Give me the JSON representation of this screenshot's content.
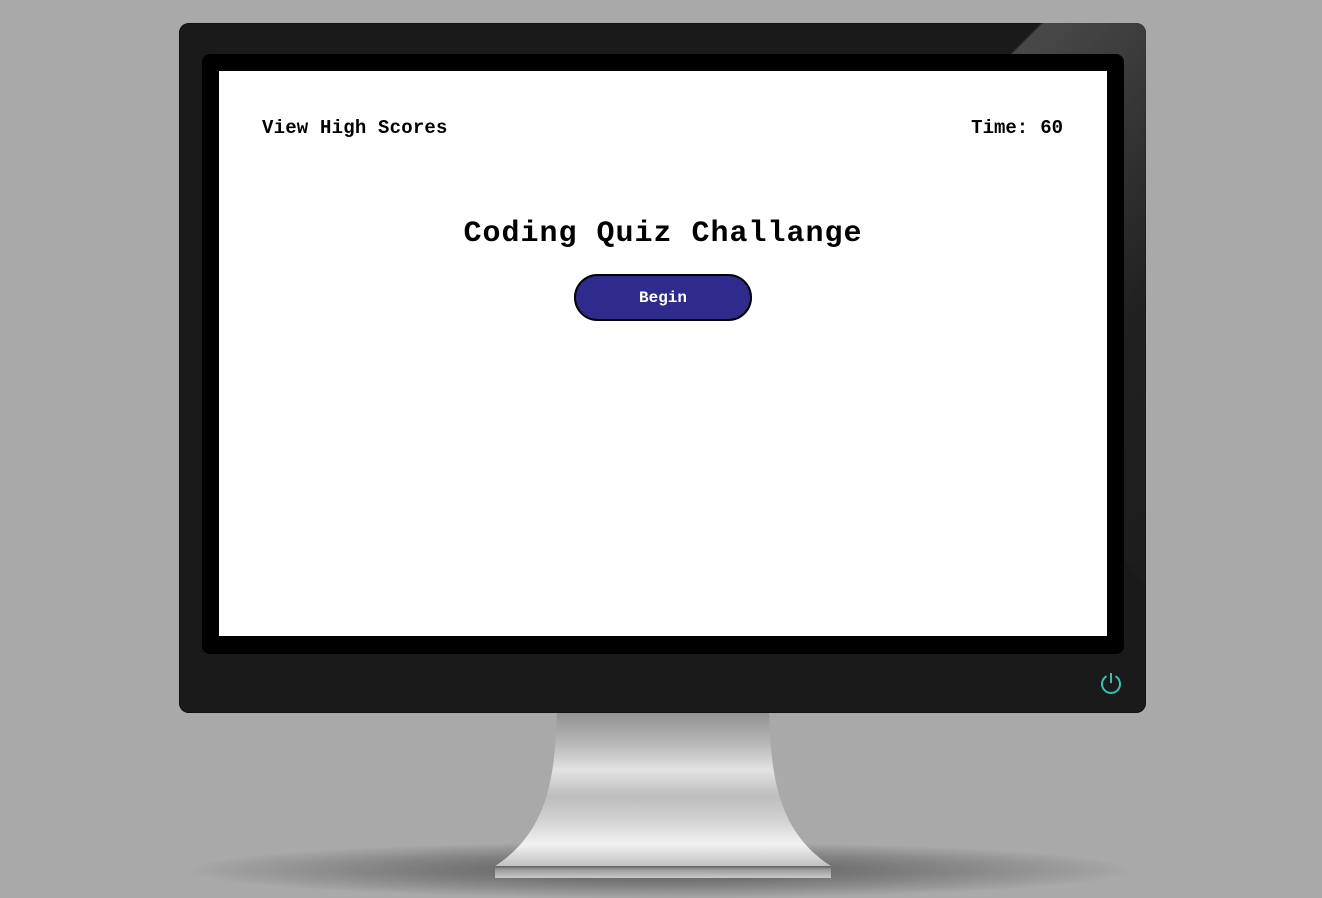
{
  "header": {
    "high_scores_link": "View High Scores",
    "timer_label": "Time:",
    "timer_value": "60"
  },
  "main": {
    "title": "Coding Quiz Challange",
    "begin_button": "Begin"
  },
  "device": {
    "power_icon": "power-icon",
    "accent_color": "#2e2b8c",
    "power_color": "#2ec4b6"
  }
}
